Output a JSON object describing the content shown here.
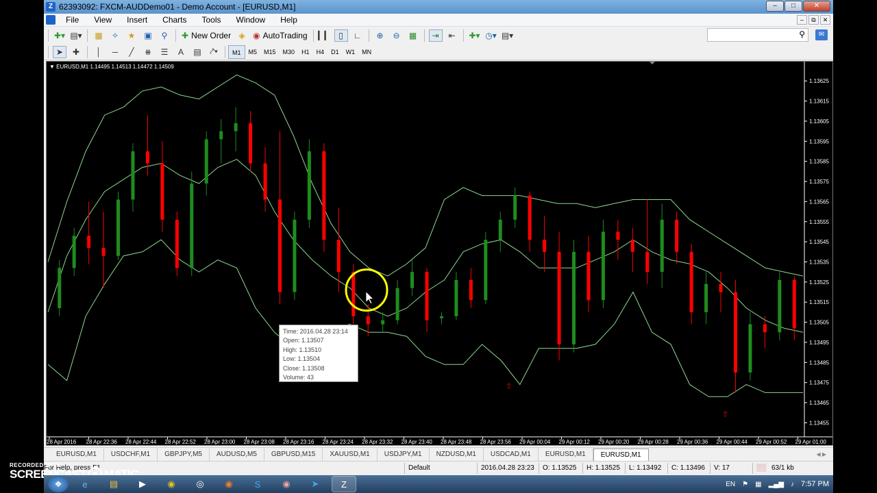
{
  "window": {
    "title": "62393092: FXCM-AUDDemo01 - Demo Account - [EURUSD,M1]"
  },
  "menu": [
    "File",
    "View",
    "Insert",
    "Charts",
    "Tools",
    "Window",
    "Help"
  ],
  "toolbar": {
    "new_order": "New Order",
    "autotrading": "AutoTrading"
  },
  "timeframes": [
    "M1",
    "M5",
    "M15",
    "M30",
    "H1",
    "H4",
    "D1",
    "W1",
    "MN"
  ],
  "chart": {
    "header": "EURUSD,M1  1.14495 1.14513 1.14472 1.14509",
    "colors": {
      "bull": "#1e8c1e",
      "bear": "#ff0000",
      "bands": "#8fd98f",
      "axis": "#ffffff",
      "cursor": "#ffff00"
    }
  },
  "tooltip": {
    "time": "Time: 2016.04.28 23:14",
    "open": "Open: 1.13507",
    "high": "High: 1.13510",
    "low": "Low:  1.13504",
    "close": "Close: 1.13508",
    "volume": "Volume: 43"
  },
  "chart_data": {
    "type": "candlestick",
    "symbol": "EURUSD",
    "timeframe": "M1",
    "price_ticks": [
      "1.13625",
      "1.13615",
      "1.13605",
      "1.13595",
      "1.13585",
      "1.13575",
      "1.13565",
      "1.13555",
      "1.13545",
      "1.13535",
      "1.13525",
      "1.13515",
      "1.13505",
      "1.13495",
      "1.13485",
      "1.13475",
      "1.13465",
      "1.13455"
    ],
    "ylim": [
      1.134497,
      1.136312
    ],
    "time_ticks": [
      "28 Apr 2016",
      "28 Apr 22:36",
      "28 Apr 22:44",
      "28 Apr 22:52",
      "28 Apr 23:00",
      "28 Apr 23:08",
      "28 Apr 23:16",
      "28 Apr 23:24",
      "28 Apr 23:32",
      "28 Apr 23:40",
      "28 Apr 23:48",
      "28 Apr 23:56",
      "29 Apr 00:04",
      "29 Apr 00:12",
      "29 Apr 00:20",
      "29 Apr 00:28",
      "29 Apr 00:36",
      "29 Apr 00:44",
      "29 Apr 00:52",
      "29 Apr 01:00"
    ],
    "bands": {
      "upper": [
        1.13535,
        1.13565,
        1.1359,
        1.13608,
        1.13612,
        1.1362,
        1.13622,
        1.13618,
        1.13616,
        1.13622,
        1.13628,
        1.13624,
        1.13618,
        1.13598,
        1.13574,
        1.13554,
        1.1354,
        1.13532,
        1.13528,
        1.13534,
        1.13542,
        1.13566,
        1.13572,
        1.13568,
        1.13568,
        1.13568,
        1.13566,
        1.13564,
        1.13564,
        1.13562,
        1.13564,
        1.13566,
        1.13566,
        1.13566,
        1.13556,
        1.1355,
        1.13544,
        1.13538,
        1.13532,
        1.1353,
        1.13528
      ],
      "middle": [
        1.1351,
        1.13538,
        1.13556,
        1.1357,
        1.13576,
        1.13582,
        1.13584,
        1.13578,
        1.13574,
        1.13582,
        1.13586,
        1.13578,
        1.1356,
        1.13546,
        1.13536,
        1.13528,
        1.13522,
        1.13512,
        1.13508,
        1.13512,
        1.1352,
        1.13526,
        1.1354,
        1.13544,
        1.13546,
        1.1354,
        1.13532,
        1.13532,
        1.13532,
        1.13536,
        1.1354,
        1.13546,
        1.1354,
        1.13536,
        1.13534,
        1.1353,
        1.13522,
        1.13512,
        1.13506,
        1.13502,
        1.135
      ],
      "lower": [
        1.13484,
        1.13476,
        1.13508,
        1.13524,
        1.13538,
        1.1354,
        1.13546,
        1.13536,
        1.1353,
        1.13536,
        1.13532,
        1.13512,
        1.135,
        1.13492,
        1.13496,
        1.13502,
        1.13504,
        1.135,
        1.135,
        1.13498,
        1.13488,
        1.13484,
        1.13484,
        1.13494,
        1.13486,
        1.13474,
        1.13492,
        1.13492,
        1.13492,
        1.13494,
        1.13504,
        1.1352,
        1.135,
        1.13494,
        1.13474,
        1.13468,
        1.13468,
        1.13474,
        1.1347,
        1.1347,
        1.1347
      ]
    },
    "candles": [
      [
        1.13512,
        1.13536,
        1.13508,
        1.13532
      ],
      [
        1.13532,
        1.13552,
        1.13528,
        1.13548
      ],
      [
        1.13548,
        1.13565,
        1.13534,
        1.13542
      ],
      [
        1.13542,
        1.1356,
        1.13522,
        1.13538
      ],
      [
        1.13538,
        1.1357,
        1.13536,
        1.13566
      ],
      [
        1.13566,
        1.13594,
        1.1356,
        1.1359
      ],
      [
        1.1359,
        1.13608,
        1.13578,
        1.13584
      ],
      [
        1.13584,
        1.13595,
        1.1355,
        1.13556
      ],
      [
        1.13556,
        1.1356,
        1.13528,
        1.13532
      ],
      [
        1.13532,
        1.1358,
        1.13528,
        1.13574
      ],
      [
        1.13574,
        1.136,
        1.13568,
        1.13596
      ],
      [
        1.13596,
        1.13606,
        1.13584,
        1.136
      ],
      [
        1.136,
        1.13612,
        1.1359,
        1.13604
      ],
      [
        1.13604,
        1.1361,
        1.1358,
        1.13584
      ],
      [
        1.13584,
        1.13592,
        1.1356,
        1.13566
      ],
      [
        1.13566,
        1.136,
        1.13514,
        1.1352
      ],
      [
        1.1352,
        1.1356,
        1.13516,
        1.13556
      ],
      [
        1.13556,
        1.13596,
        1.13552,
        1.1359
      ],
      [
        1.1359,
        1.13594,
        1.1354,
        1.13546
      ],
      [
        1.13546,
        1.13562,
        1.1352,
        1.1353
      ],
      [
        1.1353,
        1.13534,
        1.13504,
        1.13508
      ],
      [
        1.13508,
        1.13514,
        1.13498,
        1.13504
      ],
      [
        1.13504,
        1.1351,
        1.135,
        1.13506
      ],
      [
        1.13506,
        1.13526,
        1.13504,
        1.13522
      ],
      [
        1.13522,
        1.13536,
        1.13518,
        1.1353
      ],
      [
        1.1353,
        1.13532,
        1.135,
        1.13506
      ],
      [
        1.13507,
        1.1351,
        1.13504,
        1.13508
      ],
      [
        1.13508,
        1.1353,
        1.13506,
        1.13526
      ],
      [
        1.13526,
        1.13532,
        1.13512,
        1.13516
      ],
      [
        1.13516,
        1.1355,
        1.13514,
        1.13546
      ],
      [
        1.13546,
        1.1356,
        1.1354,
        1.13556
      ],
      [
        1.13556,
        1.13572,
        1.13552,
        1.13568
      ],
      [
        1.13568,
        1.1357,
        1.1354,
        1.13546
      ],
      [
        1.13546,
        1.13558,
        1.1353,
        1.1354
      ],
      [
        1.1354,
        1.1355,
        1.13486,
        1.13494
      ],
      [
        1.13494,
        1.13546,
        1.1349,
        1.1354
      ],
      [
        1.1354,
        1.13548,
        1.1351,
        1.13516
      ],
      [
        1.13516,
        1.13556,
        1.13512,
        1.1355
      ],
      [
        1.1355,
        1.13556,
        1.13536,
        1.13546
      ],
      [
        1.13546,
        1.13552,
        1.1353,
        1.1354
      ],
      [
        1.1354,
        1.13566,
        1.13524,
        1.1353
      ],
      [
        1.1353,
        1.13564,
        1.13522,
        1.13556
      ],
      [
        1.13556,
        1.1356,
        1.13534,
        1.1354
      ],
      [
        1.1354,
        1.13544,
        1.13504,
        1.1351
      ],
      [
        1.1351,
        1.1353,
        1.13504,
        1.13524
      ],
      [
        1.13524,
        1.1353,
        1.1351,
        1.1352
      ],
      [
        1.1352,
        1.13526,
        1.1347,
        1.1348
      ],
      [
        1.1348,
        1.1351,
        1.13476,
        1.13504
      ],
      [
        1.13504,
        1.13508,
        1.13492,
        1.135
      ],
      [
        1.135,
        1.1353,
        1.13496,
        1.13526
      ],
      [
        1.13526,
        1.13528,
        1.13496,
        1.13502
      ]
    ],
    "arrows": [
      1.13472,
      1.13458
    ],
    "cursor_price": 1.13521
  },
  "tabs": [
    "EURUSD,M1",
    "USDCHF,M1",
    "GBPJPY,M5",
    "AUDUSD,M5",
    "GBPUSD,M15",
    "XAUUSD,M1",
    "USDJPY,M1",
    "NZDUSD,M1",
    "USDCAD,M1",
    "EURUSD,M1",
    "EURUSD,M1"
  ],
  "active_tab": 10,
  "status": {
    "help": "For Help, press F1",
    "profile": "Default",
    "datetime": "2016.04.28 23:23",
    "open": "O: 1.13525",
    "high": "H: 1.13525",
    "low": "L: 1.13492",
    "close": "C: 1.13496",
    "volume": "V: 17",
    "traffic": "63/1 kb"
  },
  "watermark": {
    "line1": "RECORDED WITH",
    "line2a": "SCREENCAST",
    "line2b": "MATIC"
  },
  "tray": {
    "lang": "EN",
    "clock": "7:57 PM"
  }
}
